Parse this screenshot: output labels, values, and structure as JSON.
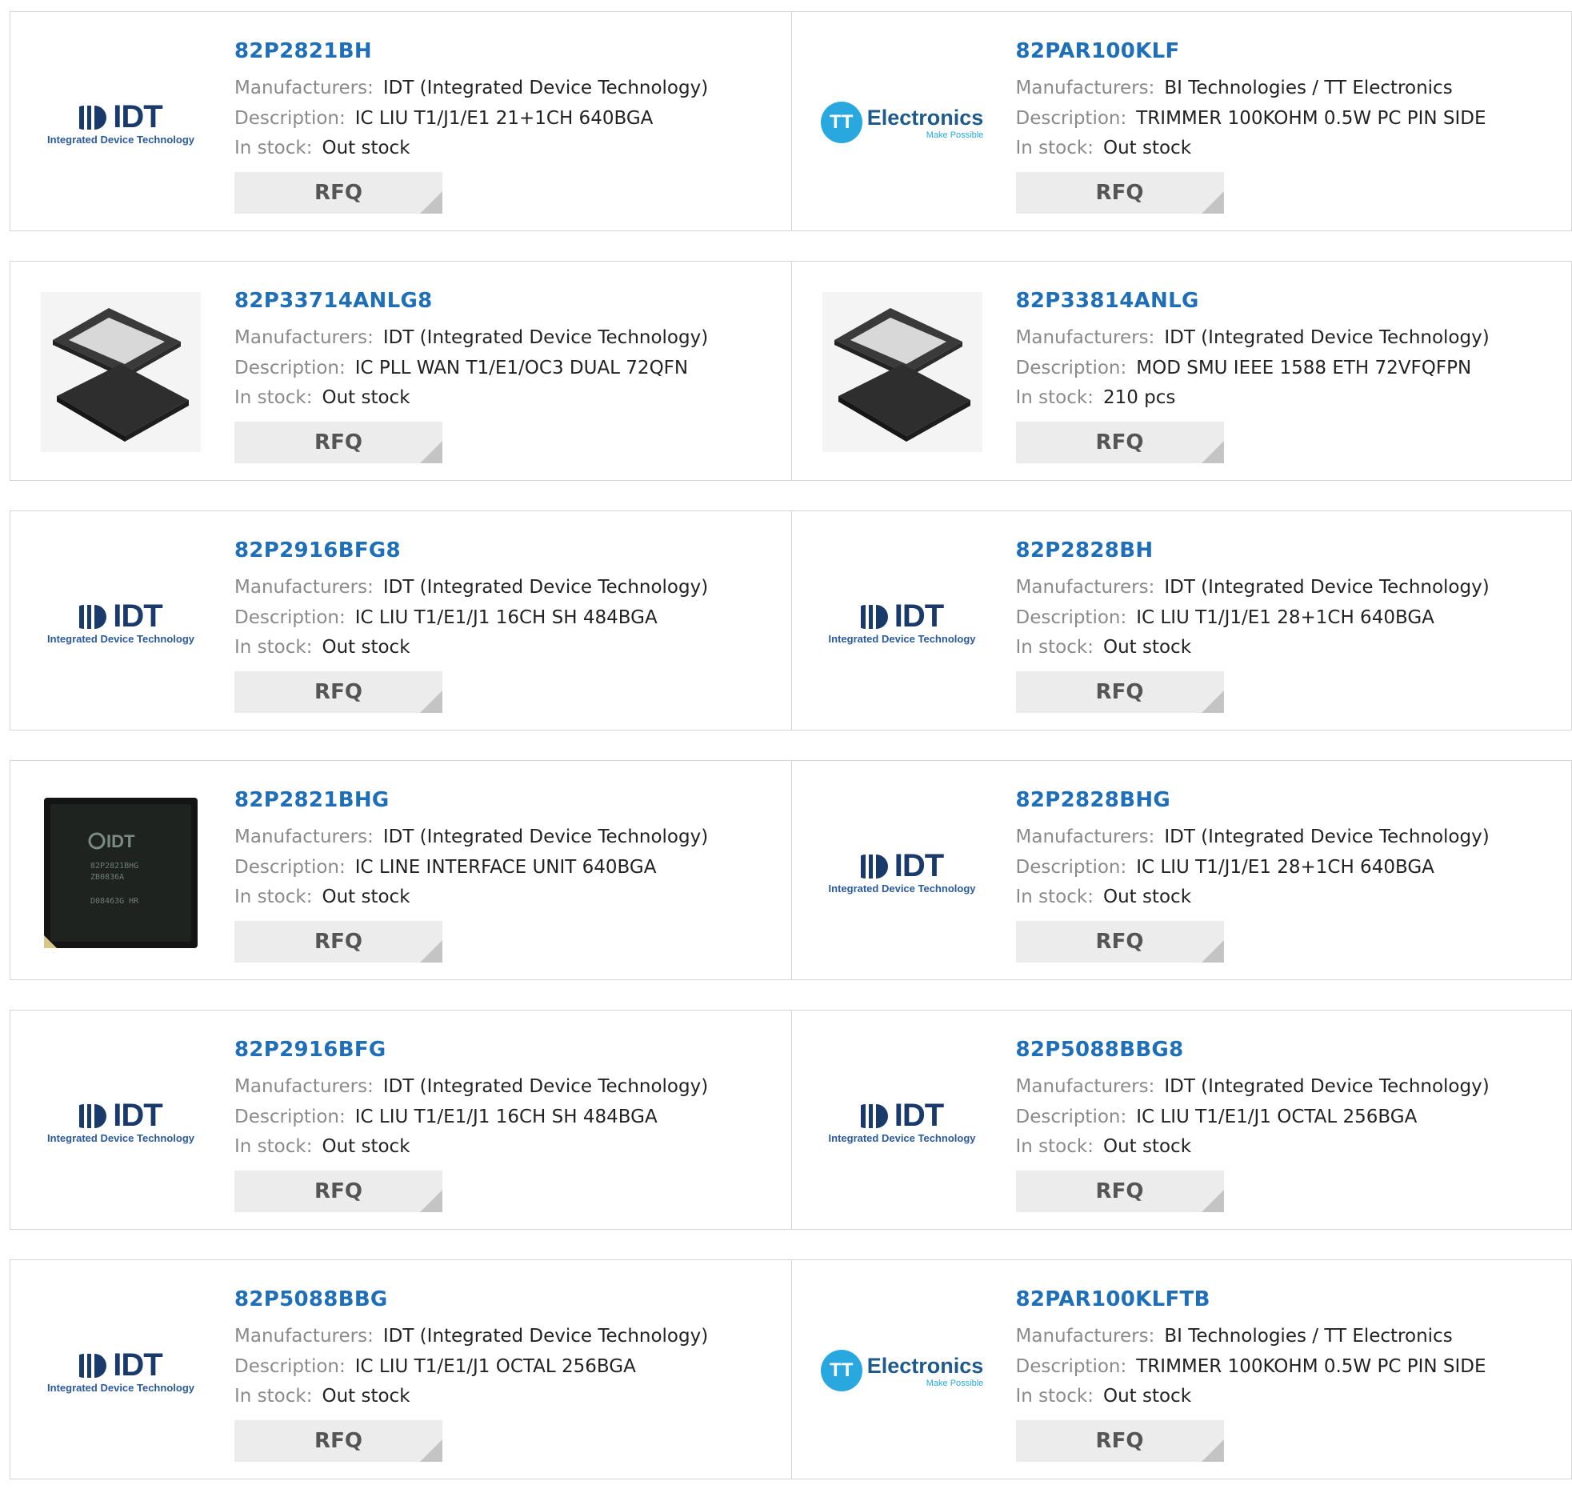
{
  "labels": {
    "manufacturers": "Manufacturers:",
    "description": "Description:",
    "in_stock": "In stock:",
    "rfq": "RFQ"
  },
  "logos": {
    "idt_word": "IDT",
    "idt_tagline": "Integrated Device Technology",
    "tt_badge": "TT",
    "tt_word": "Electronics",
    "tt_tagline": "Make Possible",
    "chip_marking": [
      "IDT",
      "82P2821BHG",
      "ZB0836A",
      "D08463G HR"
    ]
  },
  "colors": {
    "part_link": "#1e6fb8",
    "label": "#8a8a8a",
    "rfq_bg": "#ececec"
  },
  "products": [
    {
      "part": "82P2821BH",
      "manufacturer": "IDT (Integrated Device Technology)",
      "description": "IC LIU T1/J1/E1 21+1CH 640BGA",
      "stock": "Out stock",
      "image": "idt-logo"
    },
    {
      "part": "82PAR100KLF",
      "manufacturer": "BI Technologies / TT Electronics",
      "description": "TRIMMER 100KOHM 0.5W PC PIN SIDE",
      "stock": "Out stock",
      "image": "tt-logo"
    },
    {
      "part": "82P33714ANLG8",
      "manufacturer": "IDT (Integrated Device Technology)",
      "description": "IC PLL WAN T1/E1/OC3 DUAL 72QFN",
      "stock": "Out stock",
      "image": "qfn-chip"
    },
    {
      "part": "82P33814ANLG",
      "manufacturer": "IDT (Integrated Device Technology)",
      "description": "MOD SMU IEEE 1588 ETH 72VFQFPN",
      "stock": "210 pcs",
      "image": "qfn-chip"
    },
    {
      "part": "82P2916BFG8",
      "manufacturer": "IDT (Integrated Device Technology)",
      "description": "IC LIU T1/E1/J1 16CH SH 484BGA",
      "stock": "Out stock",
      "image": "idt-logo"
    },
    {
      "part": "82P2828BH",
      "manufacturer": "IDT (Integrated Device Technology)",
      "description": "IC LIU T1/J1/E1 28+1CH 640BGA",
      "stock": "Out stock",
      "image": "idt-logo"
    },
    {
      "part": "82P2821BHG",
      "manufacturer": "IDT (Integrated Device Technology)",
      "description": "IC LINE INTERFACE UNIT 640BGA",
      "stock": "Out stock",
      "image": "bga-chip"
    },
    {
      "part": "82P2828BHG",
      "manufacturer": "IDT (Integrated Device Technology)",
      "description": "IC LIU T1/J1/E1 28+1CH 640BGA",
      "stock": "Out stock",
      "image": "idt-logo"
    },
    {
      "part": "82P2916BFG",
      "manufacturer": "IDT (Integrated Device Technology)",
      "description": "IC LIU T1/E1/J1 16CH SH 484BGA",
      "stock": "Out stock",
      "image": "idt-logo"
    },
    {
      "part": "82P5088BBG8",
      "manufacturer": "IDT (Integrated Device Technology)",
      "description": "IC LIU T1/E1/J1 OCTAL 256BGA",
      "stock": "Out stock",
      "image": "idt-logo"
    },
    {
      "part": "82P5088BBG",
      "manufacturer": "IDT (Integrated Device Technology)",
      "description": "IC LIU T1/E1/J1 OCTAL 256BGA",
      "stock": "Out stock",
      "image": "idt-logo"
    },
    {
      "part": "82PAR100KLFTB",
      "manufacturer": "BI Technologies / TT Electronics",
      "description": "TRIMMER 100KOHM 0.5W PC PIN SIDE",
      "stock": "Out stock",
      "image": "tt-logo"
    }
  ]
}
